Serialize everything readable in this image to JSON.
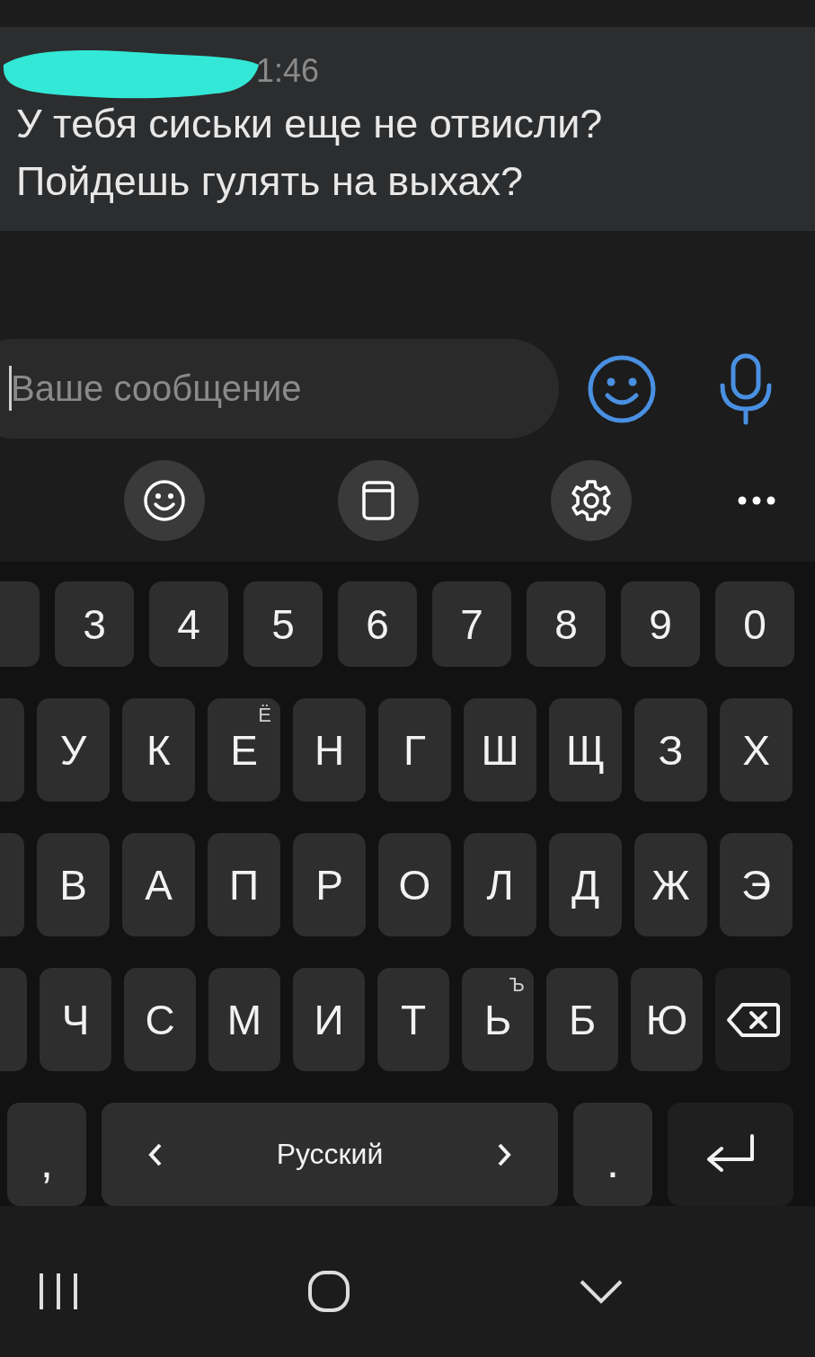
{
  "message": {
    "time": "1:46",
    "lines": [
      "У тебя сиськи еще не отвисли?",
      "Пойдешь гулять на выхах?"
    ]
  },
  "input": {
    "placeholder": "Ваше сообщение"
  },
  "keyboard": {
    "rows": [
      {
        "keys": [
          {
            "kind": "partial"
          },
          {
            "kind": "char",
            "label": "3"
          },
          {
            "kind": "char",
            "label": "4"
          },
          {
            "kind": "char",
            "label": "5"
          },
          {
            "kind": "char",
            "label": "6"
          },
          {
            "kind": "char",
            "label": "7"
          },
          {
            "kind": "char",
            "label": "8"
          },
          {
            "kind": "char",
            "label": "9"
          },
          {
            "kind": "char",
            "label": "0"
          }
        ]
      },
      {
        "keys": [
          {
            "kind": "partial"
          },
          {
            "kind": "char",
            "label": "У"
          },
          {
            "kind": "char",
            "label": "К"
          },
          {
            "kind": "char",
            "label": "Е",
            "hint": "Ё"
          },
          {
            "kind": "char",
            "label": "Н"
          },
          {
            "kind": "char",
            "label": "Г"
          },
          {
            "kind": "char",
            "label": "Ш"
          },
          {
            "kind": "char",
            "label": "Щ"
          },
          {
            "kind": "char",
            "label": "З"
          },
          {
            "kind": "char",
            "label": "Х"
          }
        ]
      },
      {
        "keys": [
          {
            "kind": "partial"
          },
          {
            "kind": "char",
            "label": "В"
          },
          {
            "kind": "char",
            "label": "А"
          },
          {
            "kind": "char",
            "label": "П"
          },
          {
            "kind": "char",
            "label": "Р"
          },
          {
            "kind": "char",
            "label": "О"
          },
          {
            "kind": "char",
            "label": "Л"
          },
          {
            "kind": "char",
            "label": "Д"
          },
          {
            "kind": "char",
            "label": "Ж"
          },
          {
            "kind": "char",
            "label": "Э"
          }
        ]
      },
      {
        "keys": [
          {
            "kind": "partial"
          },
          {
            "kind": "char",
            "label": "Ч"
          },
          {
            "kind": "char",
            "label": "С"
          },
          {
            "kind": "char",
            "label": "М"
          },
          {
            "kind": "char",
            "label": "И"
          },
          {
            "kind": "char",
            "label": "Т"
          },
          {
            "kind": "char",
            "label": "Ь",
            "hint": "Ъ"
          },
          {
            "kind": "char",
            "label": "Б"
          },
          {
            "kind": "char",
            "label": "Ю"
          },
          {
            "kind": "backspace"
          }
        ]
      },
      {
        "keys": [
          {
            "kind": "punct",
            "label": ","
          },
          {
            "kind": "space",
            "label": "Русский"
          },
          {
            "kind": "punct",
            "label": "."
          },
          {
            "kind": "enter"
          }
        ]
      }
    ]
  }
}
